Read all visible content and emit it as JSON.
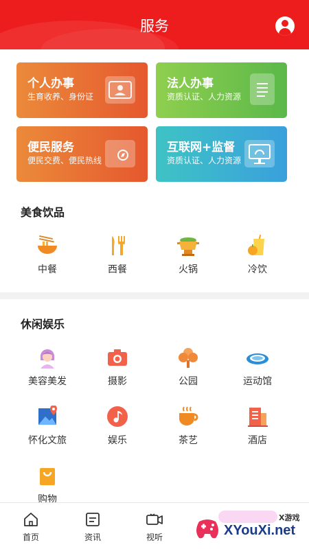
{
  "header": {
    "title": "服务"
  },
  "cards": [
    {
      "title": "个人办事",
      "subtitle": "生育收养、身份证",
      "icon": "id-card-icon"
    },
    {
      "title": "法人办事",
      "subtitle": "资质认证、人力资源",
      "icon": "document-icon"
    },
    {
      "title": "便民服务",
      "subtitle": "便民交费、便民热线",
      "icon": "folder-compass-icon"
    },
    {
      "title": "互联网+监督",
      "subtitle": "资质认证、人力资源",
      "icon": "monitor-icon"
    }
  ],
  "food": {
    "title": "美食饮品",
    "items": [
      {
        "label": "中餐",
        "icon": "noodle-bowl-icon"
      },
      {
        "label": "西餐",
        "icon": "fork-knife-icon"
      },
      {
        "label": "火锅",
        "icon": "hotpot-icon"
      },
      {
        "label": "冷饮",
        "icon": "cold-drink-icon"
      }
    ]
  },
  "leisure": {
    "title": "休闲娱乐",
    "items": [
      {
        "label": "美容美发",
        "icon": "beauty-salon-icon"
      },
      {
        "label": "摄影",
        "icon": "camera-icon"
      },
      {
        "label": "公园",
        "icon": "tree-icon"
      },
      {
        "label": "运动馆",
        "icon": "stadium-icon"
      },
      {
        "label": "怀化文旅",
        "icon": "map-pin-icon"
      },
      {
        "label": "娱乐",
        "icon": "music-note-icon"
      },
      {
        "label": "茶艺",
        "icon": "tea-cup-icon"
      },
      {
        "label": "酒店",
        "icon": "hotel-building-icon"
      },
      {
        "label": "购物",
        "icon": "shopping-bag-icon"
      }
    ]
  },
  "tabbar": [
    {
      "label": "首页",
      "icon": "home-icon"
    },
    {
      "label": "资讯",
      "icon": "news-icon"
    },
    {
      "label": "视听",
      "icon": "video-camera-icon"
    }
  ],
  "watermark": {
    "text": "XYouXi.net",
    "top": "X游戏"
  },
  "colors": {
    "brand": "#ee1d1d",
    "orange": "#e86b33",
    "green": "#6cc24a",
    "teal": "#3ab2cf"
  }
}
